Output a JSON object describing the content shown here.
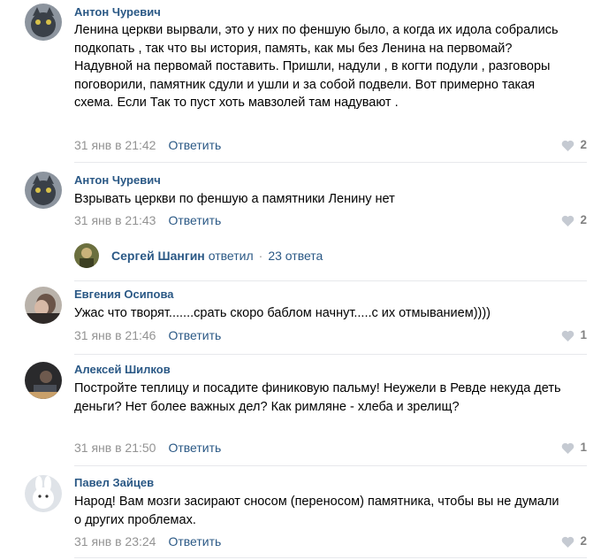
{
  "comments": [
    {
      "author": "Антон Чуревич",
      "text": "Ленина церкви вырвали, это у них по феншую было, а когда их идола собрались подкопать , так что вы история, память, как мы без Ленина на первомай? Надувной на первомай поставить. Пришли, надули , в когти подули , разговоры поговорили, памятник сдули и ушли и за собой подвели. Вот примерно такая схема. Если Так то пуст хоть мавзолей там надувают .",
      "date": "31 янв в 21:42",
      "reply_label": "Ответить",
      "likes": "2"
    },
    {
      "author": "Антон Чуревич",
      "text": "Взрывать церкви по феншую а памятники Ленину нет",
      "date": "31 янв в 21:43",
      "reply_label": "Ответить",
      "likes": "2",
      "thread": {
        "name": "Сергей Шангин",
        "verb": "ответил",
        "dot": "·",
        "count": "23 ответа"
      }
    },
    {
      "author": "Евгения Осипова",
      "text": "Ужас что творят.......срать скоро баблом начнут.....с их отмыванием))))",
      "date": "31 янв в 21:46",
      "reply_label": "Ответить",
      "likes": "1"
    },
    {
      "author": "Алексей Шилков",
      "text": "Постройте теплицу и посадите финиковую пальму! Неужели в Ревде некуда деть деньги? Нет более важных дел? Как римляне - хлеба и зрелищ?",
      "date": "31 янв в 21:50",
      "reply_label": "Ответить",
      "likes": "1"
    },
    {
      "author": "Павел Зайцев",
      "text": "Народ! Вам мозги засирают сносом (переносом) памятника, чтобы вы не думали о других проблемах.",
      "date": "31 янв в 23:24",
      "reply_label": "Ответить",
      "likes": "2"
    }
  ],
  "icons": {
    "like": "heart-icon"
  },
  "colors": {
    "link": "#2a5885",
    "muted": "#939393",
    "likes": "#828282",
    "separator": "#e7e8ec"
  }
}
